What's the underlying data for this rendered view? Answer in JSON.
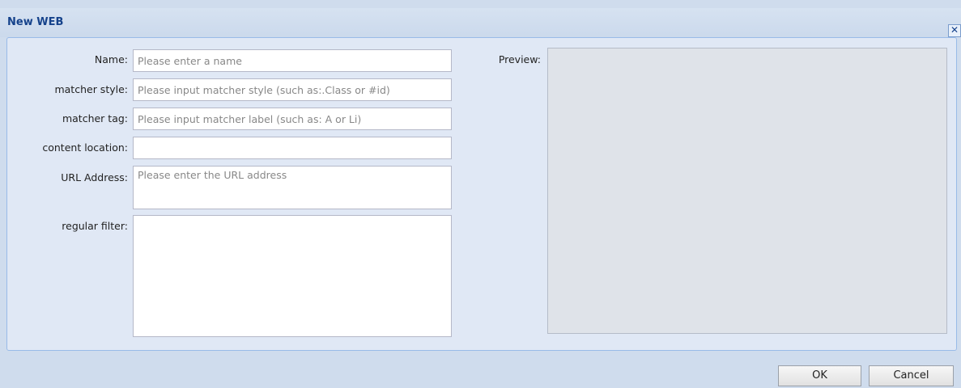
{
  "dialog": {
    "title": "New WEB",
    "close_label": "✕"
  },
  "form": {
    "name": {
      "label": "Name:",
      "placeholder": "Please enter a name",
      "value": ""
    },
    "matcher_style": {
      "label": "matcher style:",
      "placeholder": "Please input matcher style (such as:.Class or #id)",
      "value": ""
    },
    "matcher_tag": {
      "label": "matcher tag:",
      "placeholder": "Please input matcher label (such as: A or Li)",
      "value": ""
    },
    "content_location": {
      "label": "content location:",
      "placeholder": "",
      "value": ""
    },
    "url_address": {
      "label": "URL Address:",
      "placeholder": "Please enter the URL address",
      "value": ""
    },
    "regular_filter": {
      "label": "regular filter:",
      "placeholder": "",
      "value": ""
    }
  },
  "preview": {
    "label": "Preview:"
  },
  "buttons": {
    "ok": "OK",
    "cancel": "Cancel"
  }
}
